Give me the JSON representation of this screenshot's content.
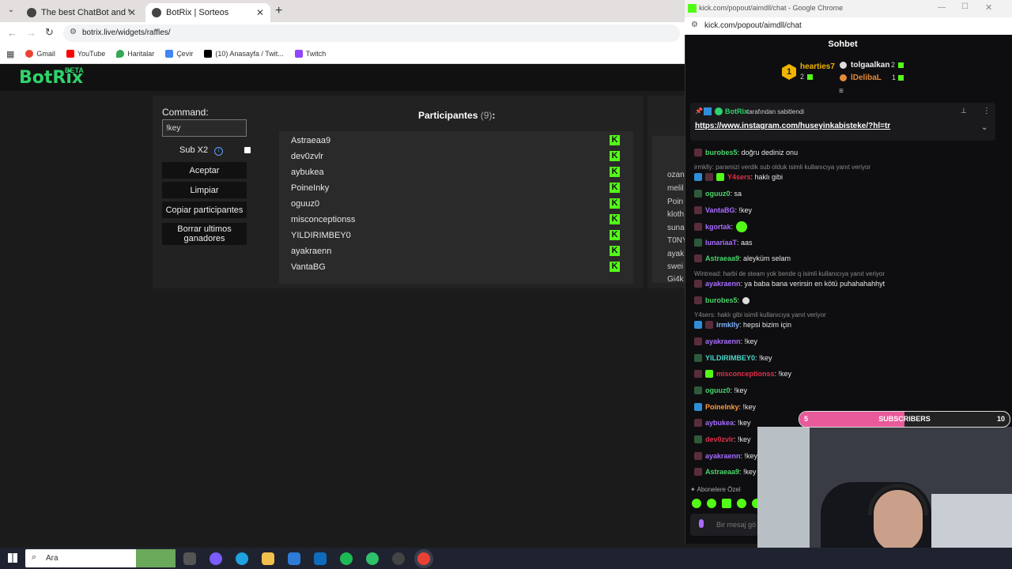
{
  "browser": {
    "tabs": [
      {
        "title": "The best ChatBot and Widgets"
      },
      {
        "title": "BotRix | Sorteos"
      }
    ],
    "new_tab": "+",
    "close": "✕",
    "url": "botrix.live/widgets/raffles/",
    "bookmarks": [
      "Gmail",
      "YouTube",
      "Haritalar",
      "Çevir",
      "(10) Anasayfa / Twit...",
      "Twitch"
    ]
  },
  "app": {
    "logo": "BotRix",
    "beta": "BETA"
  },
  "raffle": {
    "command_label": "Command:",
    "command_value": "!key",
    "sub_label": "Sub X2",
    "buttons": {
      "accept": "Aceptar",
      "clear": "Limpiar",
      "copy": "Copiar participantes",
      "delete_line1": "Borrar ultimos",
      "delete_line2": "ganadores"
    },
    "participants_title": "Participantes",
    "participants_count": "(9)",
    "participants_suffix": ":",
    "participants": [
      "Astraeaa9",
      "dev0zvlr",
      "aybukea",
      "PoineInky",
      "oguuz0",
      "misconceptionss",
      "YILDIRIMBEY0",
      "ayakraenn",
      "VantaBG"
    ],
    "platform_glyph": "K",
    "side_names": [
      "ozan",
      "melil",
      "Poin",
      "kloth",
      "suna",
      "T0NY",
      "ayak",
      "swei",
      "Gi4k"
    ]
  },
  "chat_window": {
    "window_title": "kick.com/popout/aimdll/chat - Google Chrome",
    "url": "kick.com/popout/aimdll/chat",
    "header": "Sohbet",
    "leaderboard": [
      {
        "rank": "1",
        "name": "hearties7",
        "count": "2"
      },
      {
        "name": "tolgaalkan",
        "count": "2"
      },
      {
        "name": "lDelibaL",
        "count": "1"
      }
    ],
    "pinned_by_name": "BotRix",
    "pinned_by_text": "tarafından sabitlendi",
    "pinned_link": "https://www.instagram.com/huseyinkabisteke/?hl=tr",
    "messages": [
      {
        "user": "burobes5",
        "text": ": doğru dediniz onu",
        "color": "#4ad66b"
      },
      {
        "reply": "irmklly: paramizi verdik sub olduk isimli kullanıcıya yanıt veriyor"
      },
      {
        "user": "Y4sers",
        "text": ": haklı gibi",
        "color": "#e0304a"
      },
      {
        "user": "oguuz0",
        "text": ": sa",
        "color": "#4ad66b"
      },
      {
        "user": "VantaBG",
        "text": ": !key",
        "color": "#a86bff"
      },
      {
        "user": "kgortak",
        "text": ":",
        "color": "#a86bff"
      },
      {
        "user": "lunariaaT",
        "text": ": aas",
        "color": "#a86bff"
      },
      {
        "user": "Astraeaa9",
        "text": ": aleyküm selam",
        "color": "#4ad66b"
      },
      {
        "reply": "Wintread: harbi de steam yok bende q isimli kullanıcıya yanıt veriyor"
      },
      {
        "user": "ayakraenn",
        "text": ": ya baba bana verirsin en kötü puhahahahhyt",
        "color": "#a86bff"
      },
      {
        "user": "burobes5",
        "text": ":",
        "color": "#4ad66b"
      },
      {
        "reply": "Y4sers: haklı gibi isimli kullanıcıya yanıt veriyor"
      },
      {
        "user": "irmklly",
        "text": ": hepsi bizim için",
        "color": "#7fb2ff"
      },
      {
        "user": "ayakraenn",
        "text": ": !key",
        "color": "#a86bff"
      },
      {
        "user": "YILDIRIMBEY0",
        "text": ": !key",
        "color": "#4ad6c8"
      },
      {
        "user": "misconceptionss",
        "text": ": !key",
        "color": "#e0304a"
      },
      {
        "user": "oguuz0",
        "text": ": !key",
        "color": "#4ad66b"
      },
      {
        "user": "PoineInky",
        "text": ": !key",
        "color": "#ff9a3a"
      },
      {
        "user": "aybukea",
        "text": ": !key",
        "color": "#a86bff"
      },
      {
        "user": "dev0zvlr",
        "text": ": !key",
        "color": "#e0304a"
      },
      {
        "user": "ayakraenn",
        "text": ": !key",
        "color": "#a86bff"
      },
      {
        "user": "Astraeaa9",
        "text": ": !key",
        "color": "#4ad66b"
      }
    ],
    "subscriber_mode": "Abonelere Özel",
    "input_placeholder": "Bir mesaj gö"
  },
  "subscribers_bar": {
    "left": "5",
    "label": "SUBSCRIBERS",
    "right": "10",
    "progress": 0.5
  },
  "taskbar": {
    "search": "Ara"
  },
  "colors": {
    "kick_green": "#53fc18",
    "botrix_green": "#2fd26a",
    "sub_pink": "#e85a9a"
  }
}
